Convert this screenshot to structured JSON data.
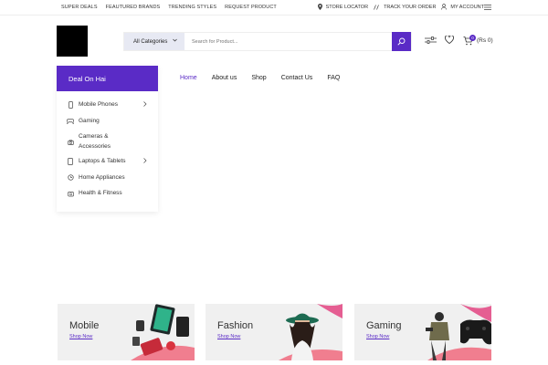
{
  "topbar": {
    "left_links": [
      "SUPER DEALS",
      "FEAUTURED BRANDS",
      "TRENDING STYLES",
      "REQUEST PRODUCT"
    ],
    "store_locator": "STORE LOCATOR",
    "track_order": "TRACK YOUR ORDER",
    "my_account": "MY ACCOUNT"
  },
  "search": {
    "category_label": "All Categories",
    "placeholder": "Search for Product..."
  },
  "cart": {
    "count": "0",
    "total": "(Rs 0)"
  },
  "sidebar": {
    "title": "Deal On Hai",
    "items": [
      {
        "label": "Mobile Phones",
        "icon": "mobile-icon",
        "has_arrow": true
      },
      {
        "label": "Gaming",
        "icon": "gamepad-icon",
        "has_arrow": false
      },
      {
        "label": "Cameras & Accessories",
        "icon": "camera-icon",
        "has_arrow": false
      },
      {
        "label": "Laptops & Tablets",
        "icon": "tablet-icon",
        "has_arrow": true
      },
      {
        "label": "Home Appliances",
        "icon": "appliance-icon",
        "has_arrow": false
      },
      {
        "label": "Health & Fitness",
        "icon": "fitness-icon",
        "has_arrow": false
      }
    ]
  },
  "nav": [
    "Home",
    "About us",
    "Shop",
    "Contact Us",
    "FAQ"
  ],
  "banners": [
    {
      "title": "Mobile",
      "link": "Shop Now"
    },
    {
      "title": "Fashion",
      "link": "Shop Now"
    },
    {
      "title": "Gaming",
      "link": "Shop Now"
    }
  ],
  "colors": {
    "accent": "#5a2bc6",
    "category_bg": "#e7e9f3",
    "banner_bg": "#f0f0f0"
  }
}
